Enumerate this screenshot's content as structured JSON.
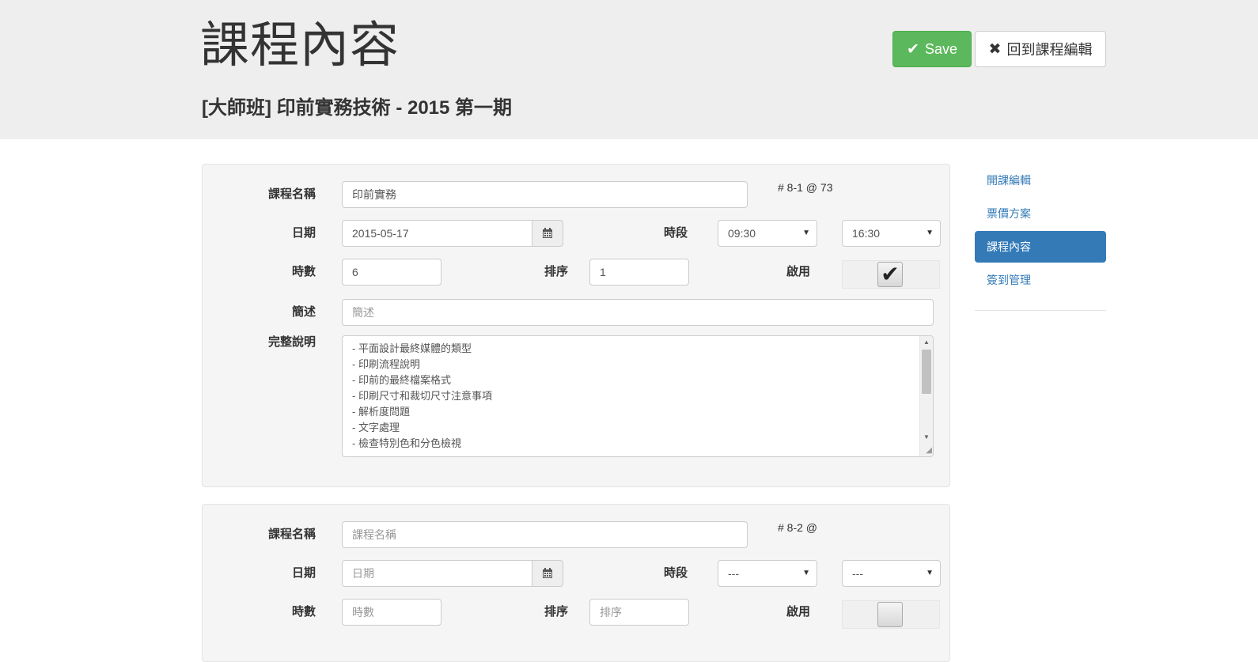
{
  "header": {
    "title": "課程內容",
    "subtitle": "[大師班] 印前實務技術 - 2015 第一期",
    "save_label": "Save",
    "back_label": "回到課程編輯"
  },
  "sidenav": {
    "items": [
      {
        "label": "開課編輯",
        "active": false
      },
      {
        "label": "票價方案",
        "active": false
      },
      {
        "label": "課程內容",
        "active": true
      },
      {
        "label": "簽到管理",
        "active": false
      }
    ]
  },
  "labels": {
    "name": "課程名稱",
    "date": "日期",
    "period": "時段",
    "hours": "時數",
    "order": "排序",
    "enabled": "啟用",
    "summary": "簡述",
    "full_desc": "完整說明"
  },
  "sessions": [
    {
      "meta": "# 8-1 @ 73",
      "name": "印前實務",
      "date": "2015-05-17",
      "start_time": "09:30",
      "end_time": "16:30",
      "hours": "6",
      "order": "1",
      "enabled": true,
      "summary_placeholder": "簡述",
      "description_lines": [
        "- 平面設計最終媒體的類型",
        "- 印刷流程說明",
        "- 印前的最終檔案格式",
        "- 印刷尺寸和裁切尺寸注意事項",
        "- 解析度問題",
        "- 文字處理",
        "- 檢查特別色和分色檢視"
      ]
    },
    {
      "meta": "# 8-2 @",
      "name_placeholder": "課程名稱",
      "date_placeholder": "日期",
      "start_time": "---",
      "end_time": "---",
      "hours_placeholder": "時數",
      "order_placeholder": "排序",
      "enabled": false
    }
  ]
}
